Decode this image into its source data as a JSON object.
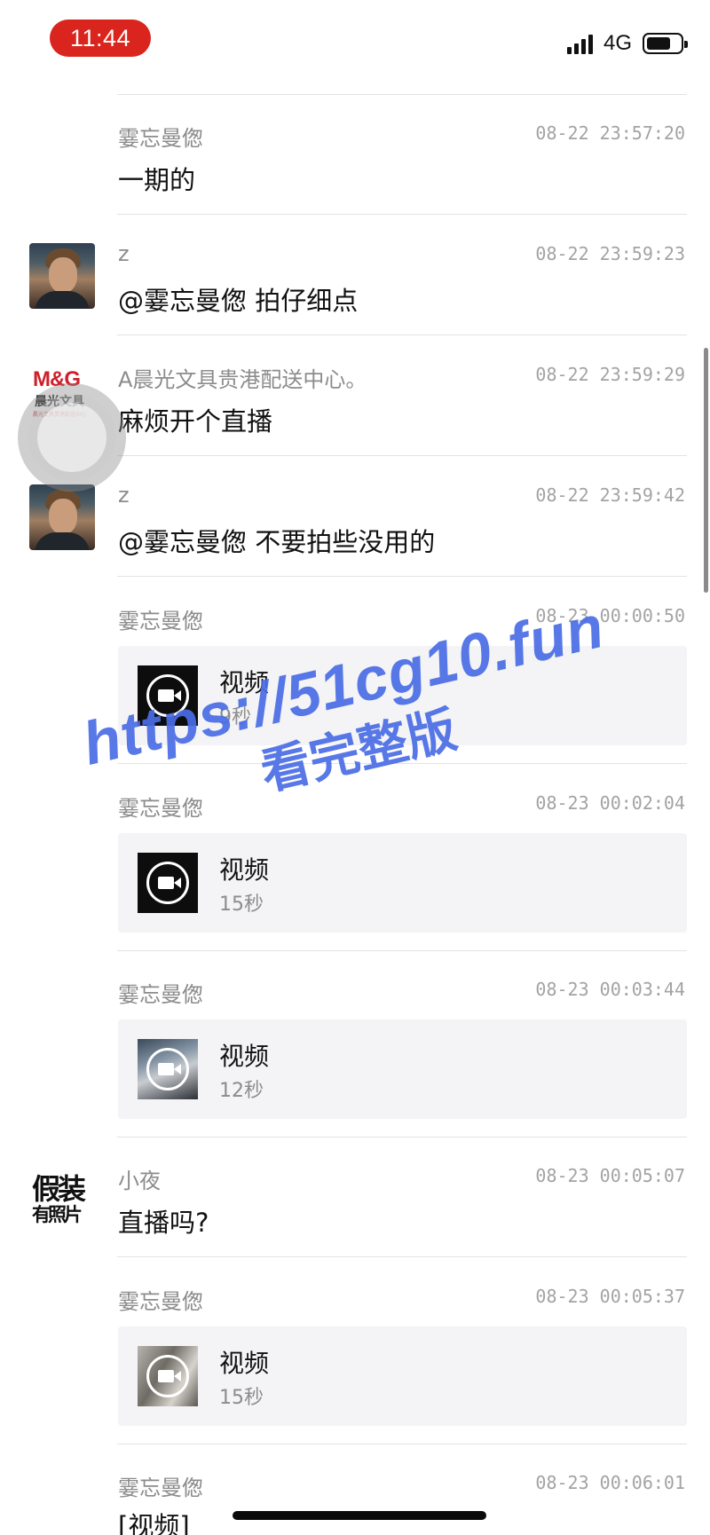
{
  "status_bar": {
    "time": "11:44",
    "network": "4G",
    "time_pill_color": "#d9251d"
  },
  "messages": [
    {
      "sender": "霎忘曼偬",
      "time": "08-22 23:57:20",
      "type": "text",
      "text": "一期的",
      "avatar": ""
    },
    {
      "sender": "z",
      "time": "08-22 23:59:23",
      "type": "text",
      "text": "@霎忘曼偬 拍仔细点",
      "avatar": "man-portrait"
    },
    {
      "sender": "A晨光文具贵港配送中心。",
      "time": "08-22 23:59:29",
      "type": "text",
      "text": "麻烦开个直播",
      "avatar": "mg-logo"
    },
    {
      "sender": "z",
      "time": "08-22 23:59:42",
      "type": "text",
      "text": "@霎忘曼偬 不要拍些没用的",
      "avatar": "man-portrait"
    },
    {
      "sender": "霎忘曼偬",
      "time": "08-23 00:00:50",
      "type": "video",
      "video_title": "视频",
      "duration": "9秒",
      "avatar": ""
    },
    {
      "sender": "霎忘曼偬",
      "time": "08-23 00:02:04",
      "type": "video",
      "video_title": "视频",
      "duration": "15秒",
      "avatar": ""
    },
    {
      "sender": "霎忘曼偬",
      "time": "08-23 00:03:44",
      "type": "video",
      "video_title": "视频",
      "duration": "12秒",
      "avatar": ""
    },
    {
      "sender": "小夜",
      "time": "08-23 00:05:07",
      "type": "text",
      "text": "直播吗?",
      "avatar": "calligraphy"
    },
    {
      "sender": "霎忘曼偬",
      "time": "08-23 00:05:37",
      "type": "video",
      "video_title": "视频",
      "duration": "15秒",
      "avatar": ""
    },
    {
      "sender": "霎忘曼偬",
      "time": "08-23 00:06:01",
      "type": "text",
      "text": "[视频]",
      "avatar": ""
    }
  ],
  "avatars": {
    "mg_logo_text": "M&G",
    "mg_chinese": "晨光文具",
    "mg_subtitle": "晨光文具贵港配送中心",
    "calligraphy_line1": "假装",
    "calligraphy_line2": "有照片"
  },
  "watermark": {
    "url": "https://51cg10.fun",
    "caption": "看完整版",
    "color": "#4a6de6"
  }
}
